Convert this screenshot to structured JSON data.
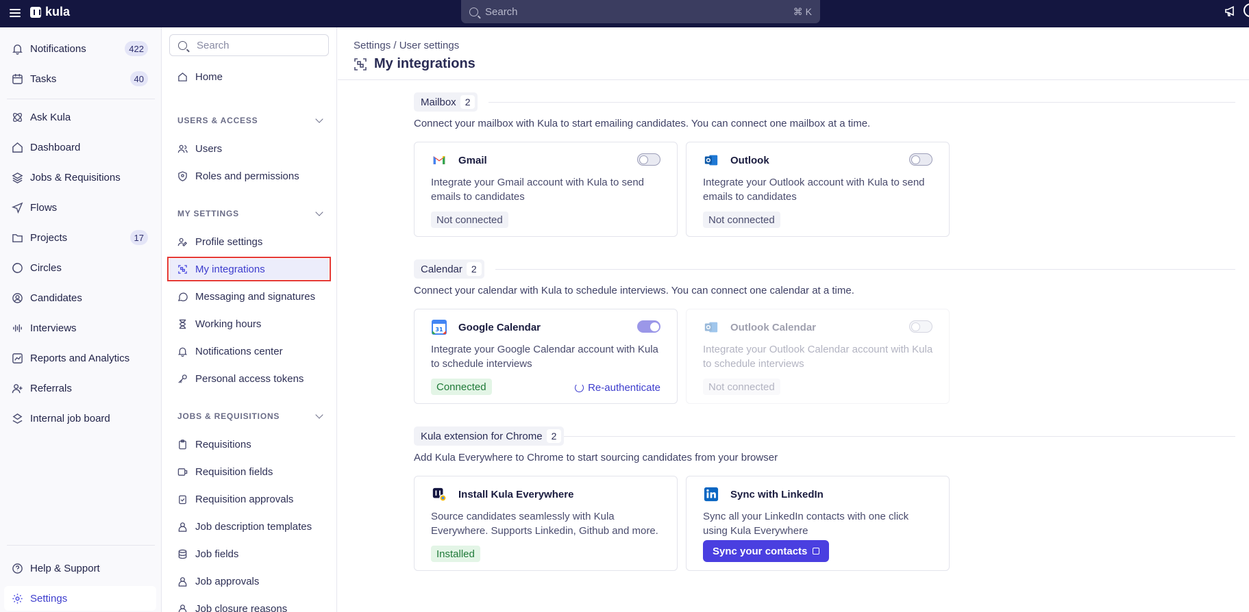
{
  "topbar": {
    "logo_text": "kula",
    "search_placeholder": "Search",
    "search_shortcut": "⌘ K"
  },
  "leftnav": {
    "items": [
      {
        "label": "Notifications",
        "count": "422",
        "icon": "bell-icon"
      },
      {
        "label": "Tasks",
        "count": "40",
        "icon": "calendar-check-icon"
      },
      {
        "label": "Ask Kula",
        "icon": "atom-icon"
      },
      {
        "label": "Dashboard",
        "icon": "home-icon"
      },
      {
        "label": "Jobs & Requisitions",
        "icon": "layers-icon"
      },
      {
        "label": "Flows",
        "icon": "send-icon"
      },
      {
        "label": "Projects",
        "count": "17",
        "icon": "folder-icon"
      },
      {
        "label": "Circles",
        "icon": "circles-icon"
      },
      {
        "label": "Candidates",
        "icon": "user-circle-icon"
      },
      {
        "label": "Interviews",
        "icon": "audio-lines-icon"
      },
      {
        "label": "Reports and Analytics",
        "icon": "chart-icon"
      },
      {
        "label": "Referrals",
        "icon": "user-plus-icon"
      },
      {
        "label": "Internal job board",
        "icon": "board-icon"
      }
    ],
    "help_label": "Help & Support",
    "settings_label": "Settings"
  },
  "settings_nav": {
    "search_placeholder": "Search",
    "home_label": "Home",
    "sections": [
      {
        "title": "USERS & ACCESS",
        "items": [
          "Users",
          "Roles and permissions"
        ]
      },
      {
        "title": "MY SETTINGS",
        "items": [
          "Profile settings",
          "My integrations",
          "Messaging and signatures",
          "Working hours",
          "Notifications center",
          "Personal access tokens"
        ]
      },
      {
        "title": "JOBS & REQUISITIONS",
        "items": [
          "Requisitions",
          "Requisition fields",
          "Requisition approvals",
          "Job description templates",
          "Job fields",
          "Job approvals",
          "Job closure reasons"
        ]
      }
    ],
    "selected": "My integrations"
  },
  "main": {
    "breadcrumb": "Settings / User settings",
    "title": "My integrations",
    "sections": [
      {
        "title": "Mailbox",
        "count": "2",
        "description": "Connect your mailbox with Kula to start emailing candidates. You can connect one mailbox at a time.",
        "cards": [
          {
            "name": "Gmail",
            "description": "Integrate your Gmail account with Kula to send emails to candidates",
            "status": "Not connected",
            "toggle": false
          },
          {
            "name": "Outlook",
            "description": "Integrate your Outlook account with Kula to send emails to candidates",
            "status": "Not connected",
            "toggle": false
          }
        ]
      },
      {
        "title": "Calendar",
        "count": "2",
        "description": "Connect your calendar with Kula to schedule interviews. You can connect one calendar at a time.",
        "cards": [
          {
            "name": "Google Calendar",
            "description": "Integrate your Google Calendar account with Kula to schedule interviews",
            "status": "Connected",
            "toggle": true,
            "action": "Re-authenticate"
          },
          {
            "name": "Outlook Calendar",
            "description": "Integrate your Outlook Calendar account with Kula to schedule interviews",
            "status": "Not connected",
            "toggle": false,
            "disabled": true
          }
        ]
      },
      {
        "title": "Kula extension for Chrome",
        "count": "2",
        "description": "Add Kula Everywhere to Chrome to start sourcing candidates from your browser",
        "cards": [
          {
            "name": "Install Kula Everywhere",
            "description": "Source candidates seamlessly with Kula Everywhere. Supports Linkedin, Github and more.",
            "status": "Installed"
          },
          {
            "name": "Sync with LinkedIn",
            "description": "Sync all your LinkedIn contacts with one click using Kula Everywhere",
            "button": "Sync your contacts"
          }
        ]
      }
    ]
  },
  "colors": {
    "topbar": "#141640",
    "accent": "#4a3fe0",
    "selected_outline": "#e53935",
    "connected_bg": "#e3f5e6"
  }
}
